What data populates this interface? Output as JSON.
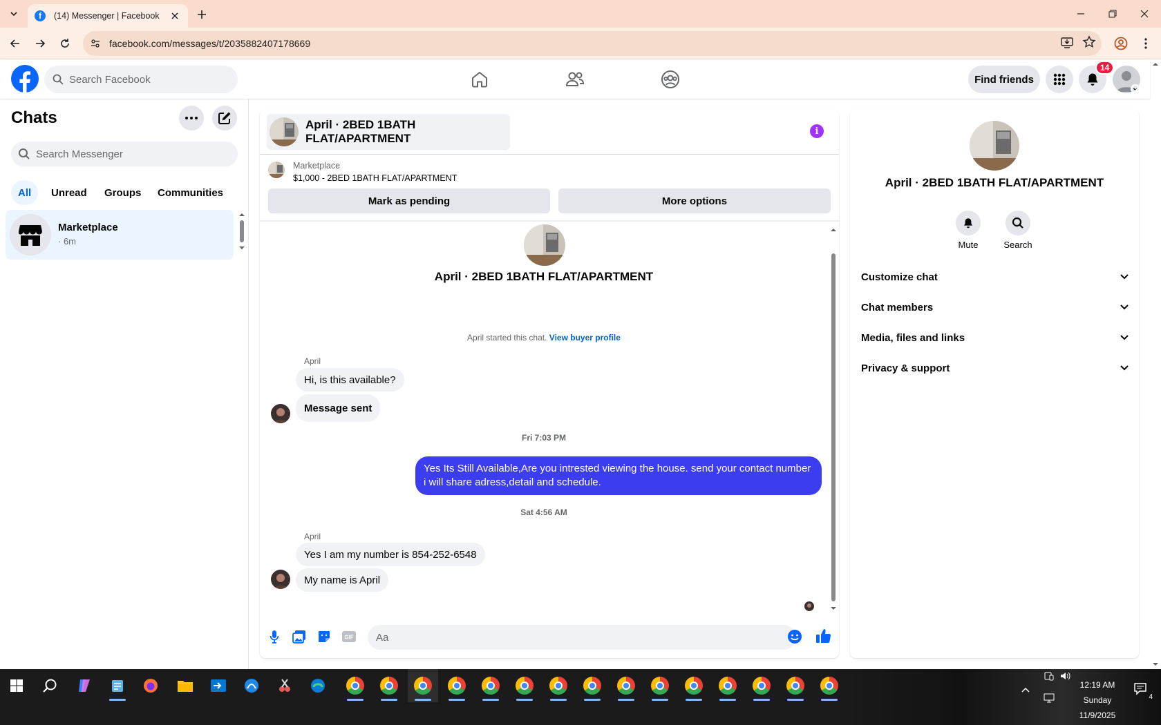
{
  "browser": {
    "tab_title": "(14) Messenger | Facebook",
    "url": "facebook.com/messages/t/2035882407178669"
  },
  "header": {
    "search_placeholder": "Search Facebook",
    "find_friends": "Find friends",
    "notification_count": "14"
  },
  "chats": {
    "title": "Chats",
    "search_placeholder": "Search Messenger",
    "filters": [
      "All",
      "Unread",
      "Groups",
      "Communities"
    ],
    "items": [
      {
        "name": "Marketplace",
        "time": "· 6m"
      }
    ]
  },
  "conversation": {
    "title": "April · 2BED 1BATH FLAT/APARTMENT",
    "marketplace_label": "Marketplace",
    "listing": "$1,000 - 2BED 1BATH FLAT/APARTMENT",
    "mark_pending": "Mark as pending",
    "more_options": "More options",
    "started_text": "April started this chat.",
    "view_buyer_profile": "View buyer profile",
    "messages": [
      {
        "sender": "April",
        "text": "Hi, is this available?"
      },
      {
        "text": "Message sent"
      },
      {
        "timestamp": "Fri 7:03 PM"
      },
      {
        "outgoing": true,
        "text": "Yes Its Still Available,Are you intrested viewing the house. send your contact number i will share adress,detail and schedule."
      },
      {
        "timestamp": "Sat 4:56 AM"
      },
      {
        "sender": "April",
        "text": "Yes I am my number is 854-252-6548"
      },
      {
        "text": "My name is April"
      }
    ],
    "composer_placeholder": "Aa"
  },
  "details": {
    "name": "April · 2BED 1BATH FLAT/APARTMENT",
    "actions": [
      "Mute",
      "Search"
    ],
    "sections": [
      "Customize chat",
      "Chat members",
      "Media, files and links",
      "Privacy & support"
    ]
  },
  "taskbar": {
    "time": "12:19 AM",
    "day": "Sunday",
    "date": "11/9/2025",
    "notification_count": "4"
  },
  "colors": {
    "accent": "#0866ff",
    "outgoing_bubble": "#3c3cf0",
    "info_icon": "#a033ff",
    "notification_badge": "#e41e3f"
  }
}
